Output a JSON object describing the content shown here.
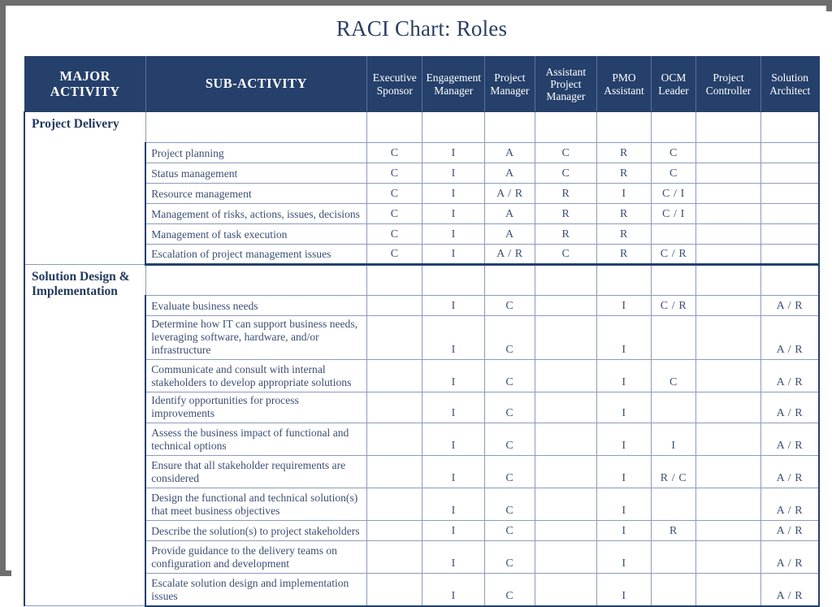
{
  "title": "RACI Chart: Roles",
  "colors": {
    "header_bg": "#25406b",
    "title_text": "#2a3f63",
    "grid_line": "#8b9cbd",
    "frame": "#6e6e6e",
    "body_text": "#3c4f73"
  },
  "table": {
    "headers": {
      "major_activity": "MAJOR\nACTIVITY",
      "major_activity_line1": "MAJOR",
      "major_activity_line2": "ACTIVITY",
      "sub_activity": "SUB-ACTIVITY",
      "roles": [
        {
          "line1": "Executive",
          "line2": "Sponsor",
          "line3": ""
        },
        {
          "line1": "Engagement",
          "line2": "Manager",
          "line3": ""
        },
        {
          "line1": "Project",
          "line2": "Manager",
          "line3": ""
        },
        {
          "line1": "Assistant",
          "line2": "Project",
          "line3": "Manager"
        },
        {
          "line1": "PMO",
          "line2": "Assistant",
          "line3": ""
        },
        {
          "line1": "OCM",
          "line2": "Leader",
          "line3": ""
        },
        {
          "line1": "Project",
          "line2": "Controller",
          "line3": ""
        },
        {
          "line1": "Solution",
          "line2": "Architect",
          "line3": ""
        }
      ]
    },
    "role_columns": [
      "Executive Sponsor",
      "Engagement Manager",
      "Project Manager",
      "Assistant Project Manager",
      "PMO Assistant",
      "OCM Leader",
      "Project Controller",
      "Solution Architect"
    ],
    "sections": [
      {
        "major_activity": "Project Delivery",
        "rows": [
          {
            "sub_activity": "",
            "values": [
              "",
              "",
              "",
              "",
              "",
              "",
              "",
              ""
            ]
          },
          {
            "sub_activity": "Project planning",
            "values": [
              "C",
              "I",
              "A",
              "C",
              "R",
              "C",
              "",
              ""
            ]
          },
          {
            "sub_activity": "Status management",
            "values": [
              "C",
              "I",
              "A",
              "C",
              "R",
              "C",
              "",
              ""
            ]
          },
          {
            "sub_activity": "Resource management",
            "values": [
              "C",
              "I",
              "A / R",
              "R",
              "I",
              "C / I",
              "",
              ""
            ]
          },
          {
            "sub_activity": "Management of risks, actions, issues, decisions",
            "values": [
              "C",
              "I",
              "A",
              "R",
              "R",
              "C / I",
              "",
              ""
            ]
          },
          {
            "sub_activity": "Management of task execution",
            "values": [
              "C",
              "I",
              "A",
              "R",
              "R",
              "",
              "",
              ""
            ]
          },
          {
            "sub_activity": "Escalation of project management issues",
            "values": [
              "C",
              "I",
              "A / R",
              "C",
              "R",
              "C / R",
              "",
              ""
            ]
          }
        ]
      },
      {
        "major_activity": "Solution Design & Implementation",
        "major_activity_line1": "Solution Design &",
        "major_activity_line2": "Implementation",
        "rows": [
          {
            "sub_activity": "",
            "values": [
              "",
              "",
              "",
              "",
              "",
              "",
              "",
              ""
            ]
          },
          {
            "sub_activity": "Evaluate business needs",
            "values": [
              "",
              "I",
              "C",
              "",
              "I",
              "C / R",
              "",
              "A / R"
            ]
          },
          {
            "sub_activity": "Determine how IT can support business needs, leveraging software, hardware, and/or infrastructure",
            "values": [
              "",
              "I",
              "C",
              "",
              "I",
              "",
              "",
              "A / R"
            ]
          },
          {
            "sub_activity": "Communicate and consult with internal stakeholders to develop appropriate solutions",
            "values": [
              "",
              "I",
              "C",
              "",
              "I",
              "C",
              "",
              "A / R"
            ]
          },
          {
            "sub_activity": "Identify opportunities for process improvements",
            "values": [
              "",
              "I",
              "C",
              "",
              "I",
              "",
              "",
              "A / R"
            ]
          },
          {
            "sub_activity": "Assess the business impact of functional and technical options",
            "values": [
              "",
              "I",
              "C",
              "",
              "I",
              "I",
              "",
              "A / R"
            ]
          },
          {
            "sub_activity": "Ensure that all stakeholder requirements are considered",
            "values": [
              "",
              "I",
              "C",
              "",
              "I",
              "R / C",
              "",
              "A / R"
            ]
          },
          {
            "sub_activity": "Design the functional and technical solution(s) that meet business objectives",
            "values": [
              "",
              "I",
              "C",
              "",
              "I",
              "",
              "",
              "A / R"
            ]
          },
          {
            "sub_activity": "Describe the solution(s) to project stakeholders",
            "values": [
              "",
              "I",
              "C",
              "",
              "I",
              "R",
              "",
              "A / R"
            ]
          },
          {
            "sub_activity": "Provide guidance to the delivery teams on configuration and development",
            "values": [
              "",
              "I",
              "C",
              "",
              "I",
              "",
              "",
              "A / R"
            ]
          },
          {
            "sub_activity": "Escalate solution design and implementation issues",
            "values": [
              "",
              "I",
              "C",
              "",
              "I",
              "",
              "",
              "A / R"
            ]
          }
        ]
      }
    ]
  }
}
